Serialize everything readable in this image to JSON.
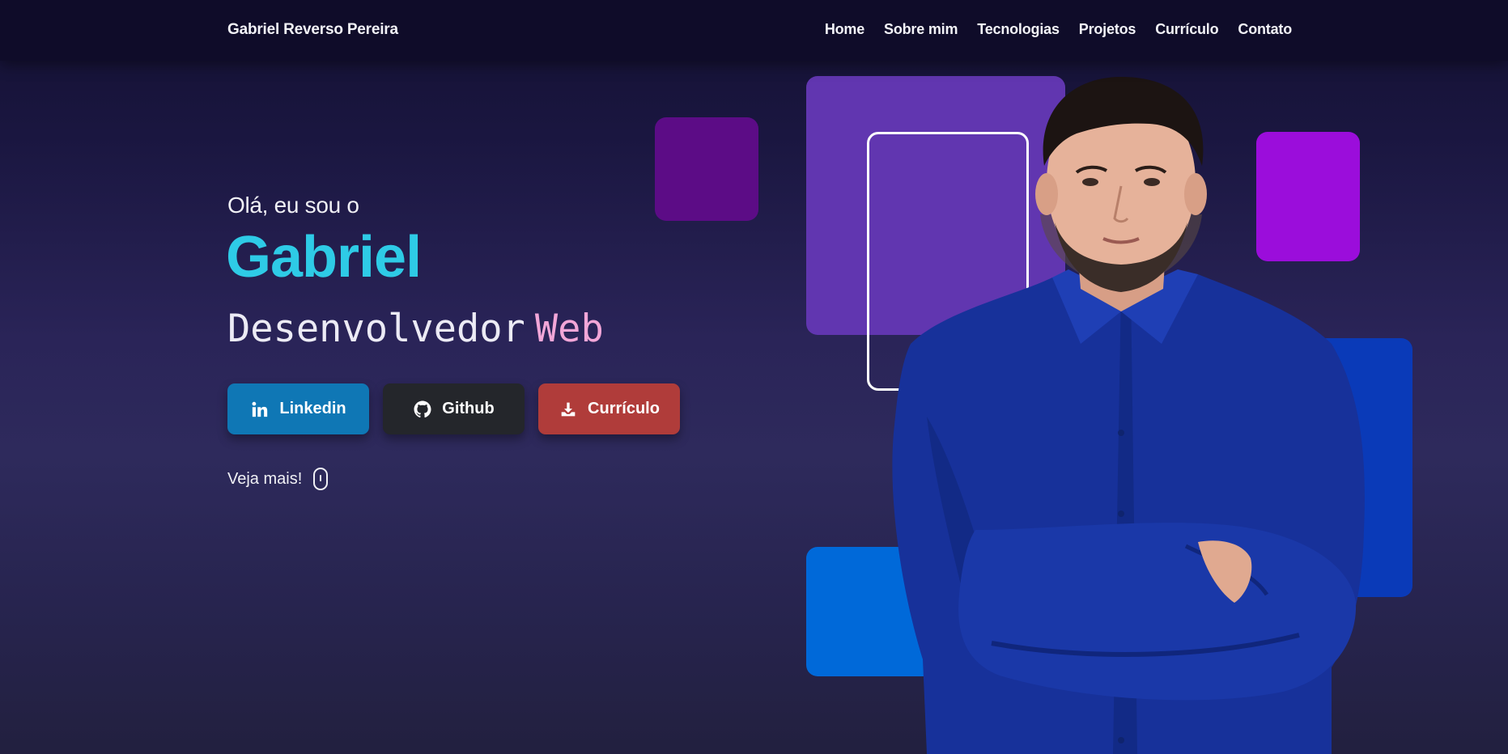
{
  "navbar": {
    "brand": "Gabriel Reverso Pereira",
    "links": [
      "Home",
      "Sobre mim",
      "Tecnologias",
      "Projetos",
      "Currículo",
      "Contato"
    ]
  },
  "hero": {
    "greeting": "Olá, eu sou o",
    "name": "Gabriel",
    "role_main": "Desenvolvedor",
    "role_accent": "Web",
    "buttons": {
      "linkedin": "Linkedin",
      "github": "Github",
      "cv": "Currículo"
    },
    "see_more": "Veja mais!"
  },
  "icons": {
    "linkedin": "linkedin-icon",
    "github": "github-icon",
    "cv": "download-icon",
    "see_more": "mouse-icon"
  },
  "colors": {
    "name": "#2ecbe6",
    "role_accent": "#f2a6d8",
    "linkedin": "#0f77b5",
    "github": "#24262b",
    "cv": "#b03c3a",
    "navbar": "#0f0c29"
  }
}
